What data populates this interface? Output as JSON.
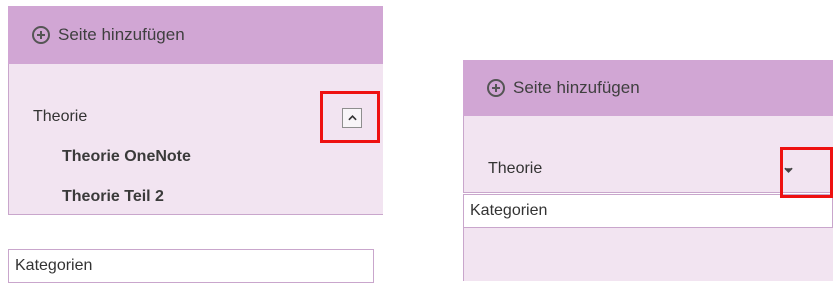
{
  "left_panel": {
    "add_page_label": "Seite hinzufügen",
    "pages": [
      {
        "label": "Theorie",
        "level": 1
      },
      {
        "label": "Theorie OneNote",
        "level": 2
      },
      {
        "label": "Theorie Teil 2",
        "level": 2
      }
    ],
    "section_label": "Kategorien",
    "toggle_icon": "chevron-up-icon"
  },
  "right_panel": {
    "add_page_label": "Seite hinzufügen",
    "pages": [
      {
        "label": "Theorie",
        "level": 1
      }
    ],
    "section_label": "Kategorien",
    "toggle_icon": "chevron-down-icon"
  },
  "colors": {
    "header_bg": "#d1a6d4",
    "pages_bg": "#f2e4f1",
    "highlight": "#ee1111"
  }
}
